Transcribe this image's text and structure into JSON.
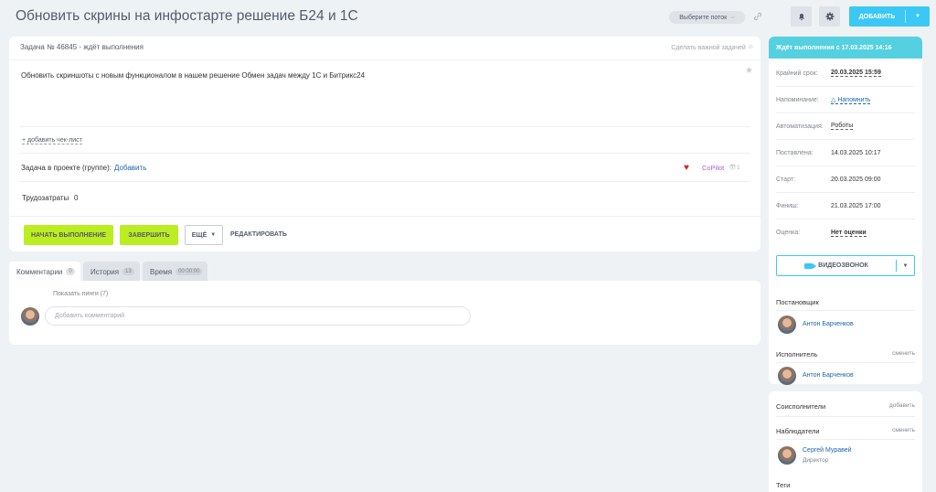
{
  "header": {
    "title": "Обновить скрины на инфостарте решение Б24 и 1С",
    "flow_select": "Выберите поток",
    "add_button": "ДОБАВИТЬ"
  },
  "task": {
    "number_status": "Задача № 46845 - ждёт выполнения",
    "make_important": "Сделать важной задачей",
    "description": "Обновить скриншоты с новым функционалом в нашем решение Обмен задач между 1С и Битрикс24",
    "add_checklist": "+ добавить чек-лист",
    "project_label": "Задача в проекте (группе):",
    "project_add": "Добавить",
    "copilot": "CoPilot",
    "views": "1",
    "labor_label": "Трудозатраты",
    "labor_value": "0",
    "buttons": {
      "start": "НАЧАТЬ ВЫПОЛНЕНИЕ",
      "finish": "ЗАВЕРШИТЬ",
      "more": "ЕЩЁ",
      "edit": "РЕДАКТИРОВАТЬ"
    }
  },
  "tabs": [
    {
      "label": "Комментарии",
      "count": "0"
    },
    {
      "label": "История",
      "count": "13"
    },
    {
      "label": "Время",
      "count": "00:00:00"
    }
  ],
  "comments": {
    "show_pings": "Показать пинги (7)",
    "placeholder": "Добавить комментарий"
  },
  "sidebar": {
    "status": "Ждёт выполнения с 17.03.2025 14:16",
    "rows": [
      {
        "key": "Крайний срок:",
        "value": "20.03.2025 15:59"
      },
      {
        "key": "Напоминание:",
        "value": "Напомнить"
      },
      {
        "key": "Автоматизация:",
        "value": "Роботы"
      },
      {
        "key": "Поставлена:",
        "value": "14.03.2025 10:17"
      },
      {
        "key": "Старт:",
        "value": "20.03.2025 09:00"
      },
      {
        "key": "Финиш:",
        "value": "21.03.2025 17:00"
      },
      {
        "key": "Оценка:",
        "value": "Нет оценки"
      }
    ],
    "video_call": "ВИДЕОЗВОНОК",
    "creator_title": "Постановщик",
    "creator_name": "Антон Барченков",
    "assignee_title": "Исполнитель",
    "assignee_action": "сменить",
    "assignee_name": "Антон Барченков",
    "coassignees_title": "Соисполнители",
    "coassignees_action": "добавить",
    "observers_title": "Наблюдатели",
    "observers_action": "сменить",
    "observer_name": "Сергей Муравей",
    "observer_position": "Директор",
    "tags_title": "Теги"
  }
}
